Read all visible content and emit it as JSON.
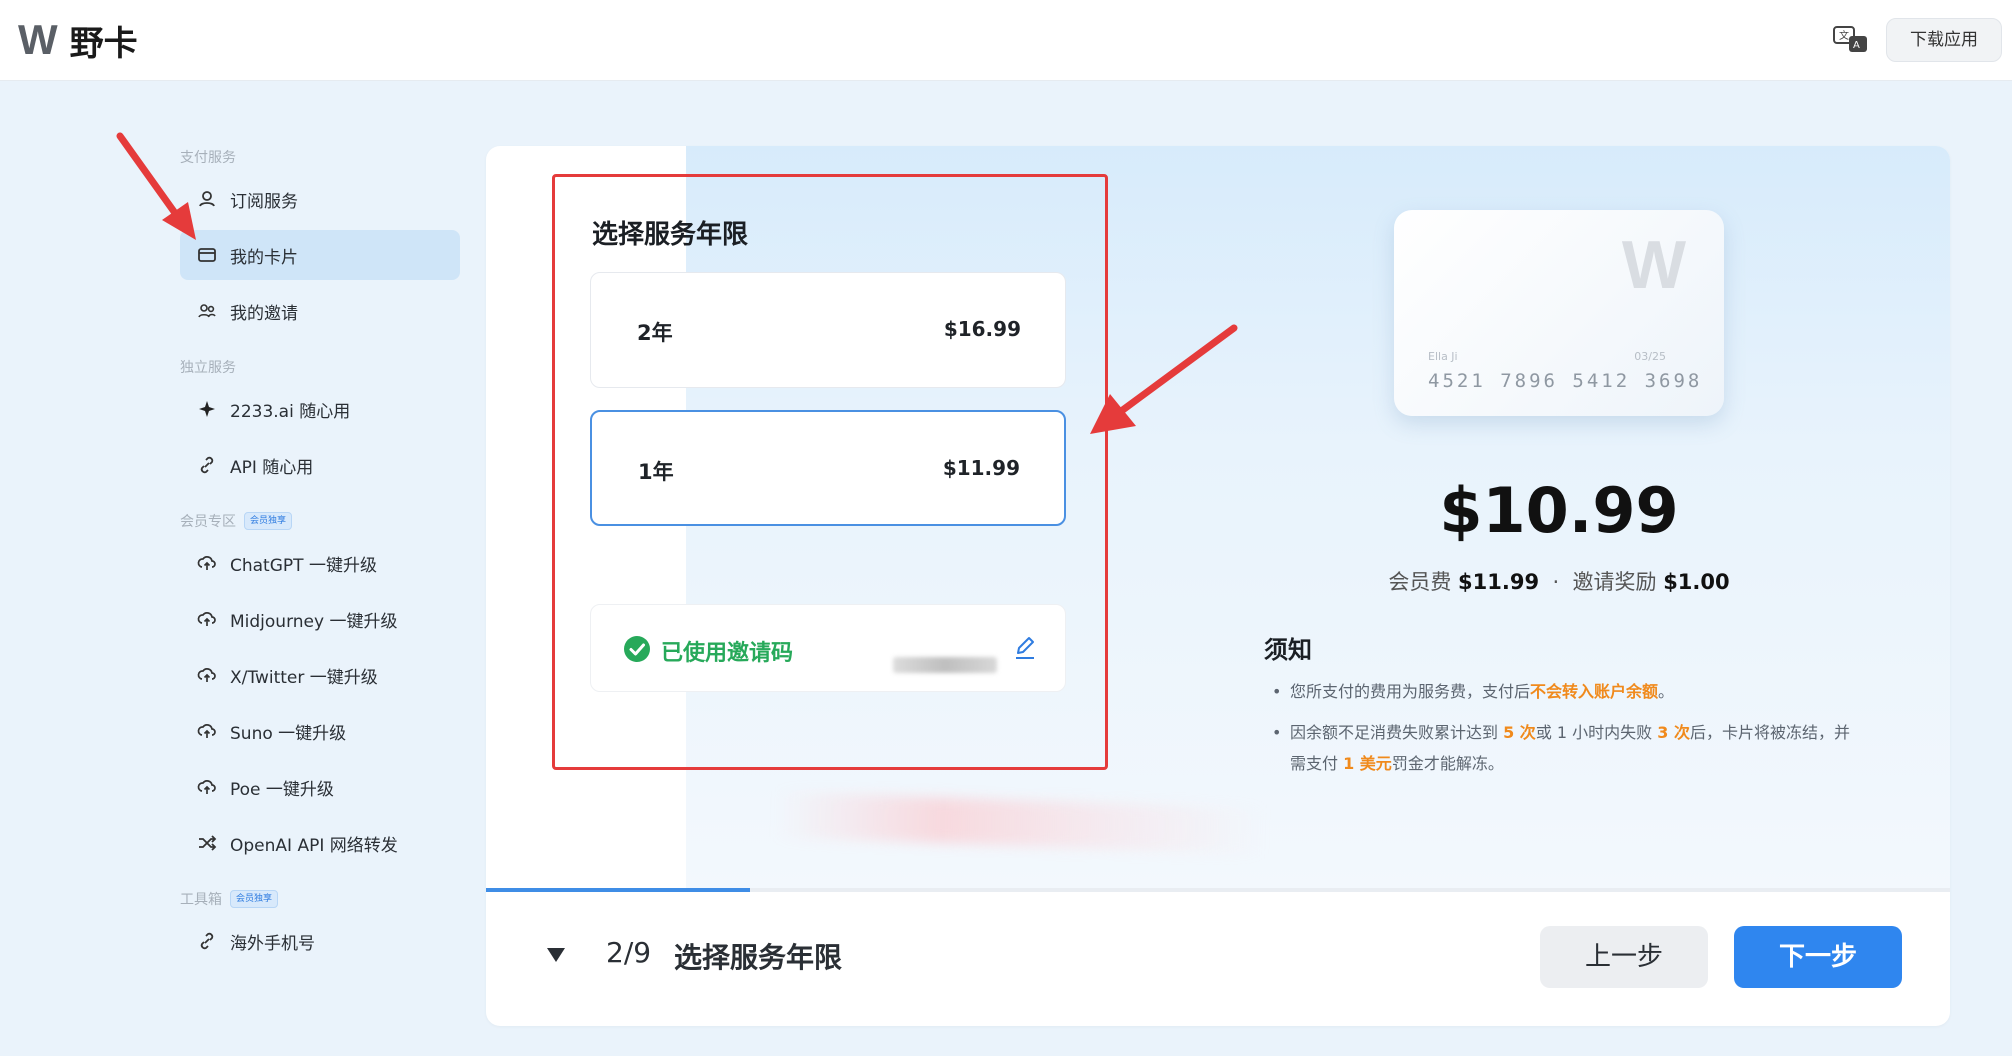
{
  "header": {
    "logo_mark": "W",
    "app_name": "野卡",
    "language_icon": "translate-icon",
    "download_label": "下载应用"
  },
  "sidebar": {
    "sections": [
      {
        "title": "支付服务",
        "badge": "",
        "items": [
          {
            "label": "订阅服务",
            "icon": "subscription-icon",
            "active": false
          },
          {
            "label": "我的卡片",
            "icon": "card-icon",
            "active": true
          },
          {
            "label": "我的邀请",
            "icon": "users-icon",
            "active": false
          }
        ]
      },
      {
        "title": "独立服务",
        "badge": "",
        "items": [
          {
            "label": "2233.ai 随心用",
            "icon": "sparkle-icon",
            "active": false
          },
          {
            "label": "API 随心用",
            "icon": "link-icon",
            "active": false
          }
        ]
      },
      {
        "title": "会员专区",
        "badge": "会员独享",
        "items": [
          {
            "label": "ChatGPT 一键升级",
            "icon": "cloud-up-icon",
            "active": false
          },
          {
            "label": "Midjourney 一键升级",
            "icon": "cloud-up-icon",
            "active": false
          },
          {
            "label": "X/Twitter 一键升级",
            "icon": "cloud-up-icon",
            "active": false
          },
          {
            "label": "Suno 一键升级",
            "icon": "cloud-up-icon",
            "active": false
          },
          {
            "label": "Poe 一键升级",
            "icon": "cloud-up-icon",
            "active": false
          },
          {
            "label": "OpenAI API 网络转发",
            "icon": "shuffle-icon",
            "active": false
          }
        ]
      },
      {
        "title": "工具箱",
        "badge": "会员独享",
        "items": [
          {
            "label": "海外手机号",
            "icon": "link-icon",
            "active": false
          }
        ]
      }
    ]
  },
  "plan_selection": {
    "heading": "选择服务年限",
    "options": [
      {
        "name": "2年",
        "price": "$16.99",
        "selected": false
      },
      {
        "name": "1年",
        "price": "$11.99",
        "selected": true
      }
    ],
    "invite_status": "已使用邀请码"
  },
  "summary": {
    "card": {
      "logo": "W",
      "holder": "Ella Ji",
      "expiry": "03/25",
      "number": "4521 7896 5412 3698"
    },
    "total": "$10.99",
    "fee_label": "会员费",
    "fee_value": "$11.99",
    "separator": "·",
    "reward_label": "邀请奖励",
    "reward_value": "$1.00",
    "notice_title": "须知",
    "notice_1_pre": "您所支付的费用为服务费，支付后",
    "notice_1_hl": "不会转入账户余额",
    "notice_1_post": "。",
    "notice_2_a": "因余额不足消费失败累计达到 ",
    "notice_2_hl1": "5 次",
    "notice_2_b": "或 1 小时内失败 ",
    "notice_2_hl2": "3 次",
    "notice_2_c": "后，卡片将被冻结，并需支付 ",
    "notice_2_hl3": "1 美元",
    "notice_2_d": "罚金才能解冻。"
  },
  "footer": {
    "progress": 0.18,
    "step": "2/9",
    "step_title": "选择服务年限",
    "prev_label": "上一步",
    "next_label": "下一步"
  },
  "colors": {
    "accent": "#2f86ef",
    "highlight": "#f08a1c",
    "success": "#27a95a",
    "annotation": "#e53b3b"
  }
}
